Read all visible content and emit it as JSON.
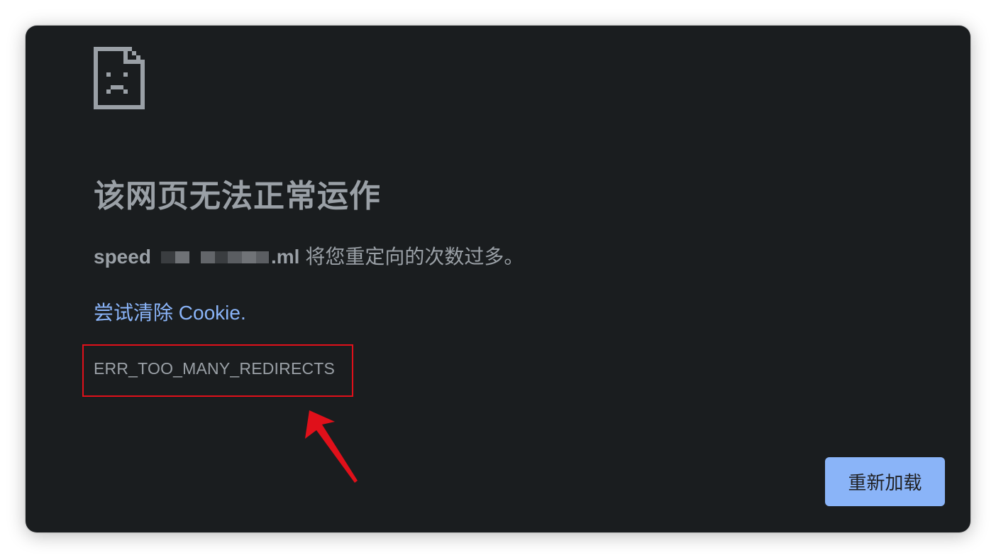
{
  "error_page": {
    "title": "该网页无法正常运作",
    "host_prefix": "speed",
    "host_suffix": ".ml",
    "message_rest": "将您重定向的次数过多。",
    "cookie_link": "尝试清除 Cookie.",
    "error_code": "ERR_TOO_MANY_REDIRECTS",
    "reload_label": "重新加载"
  },
  "colors": {
    "background": "#1a1d1f",
    "text": "#9aa0a6",
    "link": "#8ab4f8",
    "button": "#8ab4f8",
    "highlight_box": "#e0101a",
    "arrow": "#e0101a"
  },
  "icons": {
    "page_icon": "sad-page-icon",
    "annotation": "red-arrow-icon"
  }
}
